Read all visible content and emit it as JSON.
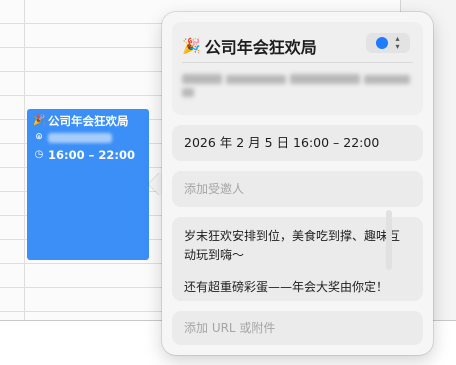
{
  "event_block": {
    "title": "公司年会狂欢局",
    "emoji": "🎉",
    "time": "16:00 – 22:00",
    "color": "#3b8ff7"
  },
  "popover": {
    "title": "公司年会狂欢局",
    "emoji": "🎉",
    "calendar_color": "#1f7bff",
    "datetime": "2026 年 2 月 5 日  16:00 – 22:00",
    "invitees_placeholder": "添加受邀人",
    "notes_line1": "岁末狂欢安排到位，美食吃到撑、趣味互动玩到嗨～",
    "notes_line2": "还有超重磅彩蛋——年会大奖由你定！",
    "url_placeholder": "添加 URL 或附件"
  }
}
